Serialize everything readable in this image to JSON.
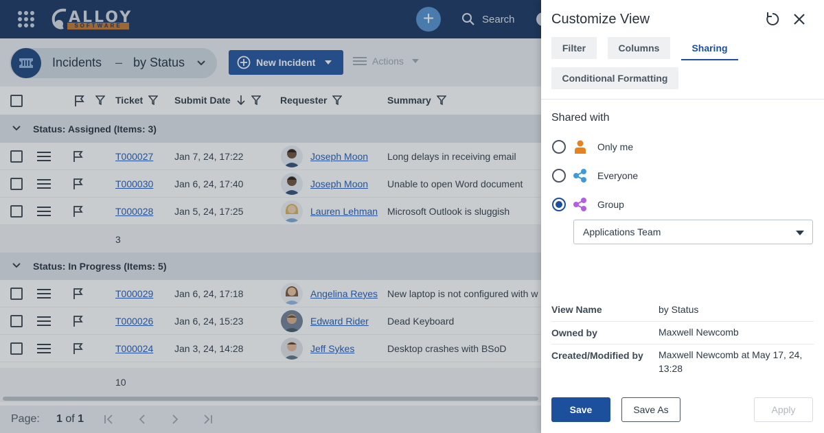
{
  "nav": {
    "logo_text": "ALLOY",
    "logo_sub": "SOFTWARE",
    "search_label": "Search"
  },
  "toolbar": {
    "title": "Incidents",
    "separator": "–",
    "view": "by Status",
    "new_button": "New Incident",
    "actions": "Actions"
  },
  "grid": {
    "columns": [
      "Ticket",
      "Submit Date",
      "Requester",
      "Summary"
    ],
    "groups": [
      {
        "label": "Status: Assigned (Items: 3)",
        "rows": [
          {
            "ticket": "T000027",
            "date": "Jan 7, 24, 17:22",
            "requester": "Joseph Moon",
            "summary": "Long delays in receiving email"
          },
          {
            "ticket": "T000030",
            "date": "Jan 6, 24, 17:40",
            "requester": "Joseph Moon",
            "summary": "Unable to open Word document"
          },
          {
            "ticket": "T000028",
            "date": "Jan 5, 24, 17:25",
            "requester": "Lauren Lehman",
            "summary": "Microsoft Outlook is sluggish"
          }
        ],
        "count": "3"
      },
      {
        "label": "Status: In Progress (Items: 5)",
        "rows": [
          {
            "ticket": "T000029",
            "date": "Jan 6, 24, 17:18",
            "requester": "Angelina Reyes",
            "summary": "New laptop is not configured with w"
          },
          {
            "ticket": "T000026",
            "date": "Jan 6, 24, 15:23",
            "requester": "Edward Rider",
            "summary": "Dead Keyboard"
          },
          {
            "ticket": "T000024",
            "date": "Jan 3, 24, 14:28",
            "requester": "Jeff Sykes",
            "summary": "Desktop crashes with BSoD"
          }
        ],
        "count": "10"
      }
    ]
  },
  "pager": {
    "label": "Page:",
    "current": "1",
    "of": "of",
    "total": "1"
  },
  "panel": {
    "title": "Customize View",
    "tabs": [
      "Filter",
      "Columns",
      "Sharing",
      "Conditional Formatting"
    ],
    "active_tab": "Sharing",
    "shared_with_heading": "Shared with",
    "options": [
      {
        "label": "Only me",
        "selected": false
      },
      {
        "label": "Everyone",
        "selected": false
      },
      {
        "label": "Group",
        "selected": true
      }
    ],
    "group_select": "Applications Team",
    "meta": [
      {
        "key": "View Name",
        "value": "by Status"
      },
      {
        "key": "Owned by",
        "value": "Maxwell Newcomb"
      },
      {
        "key": "Created/Modified by",
        "value": "Maxwell Newcomb at May 17, 24, 13:28"
      }
    ],
    "buttons": {
      "save": "Save",
      "save_as": "Save As",
      "apply": "Apply"
    },
    "colors": {
      "only_me": "#e8821e",
      "everyone": "#3f9ad8",
      "group": "#b45ee0",
      "primary": "#1c4f9c"
    }
  }
}
